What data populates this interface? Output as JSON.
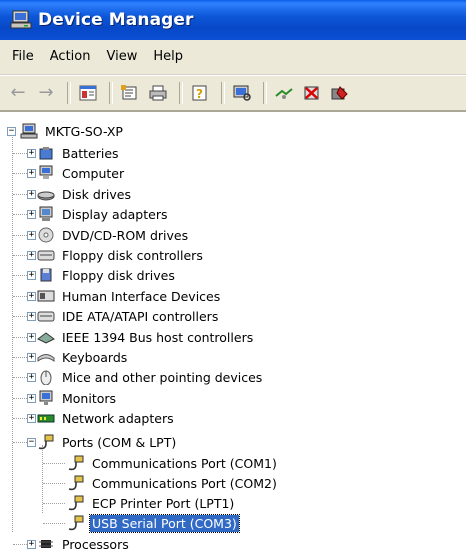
{
  "window": {
    "title": "Device Manager"
  },
  "menu": [
    "File",
    "Action",
    "View",
    "Help"
  ],
  "toolbar_icons": [
    "back-icon",
    "forward-icon",
    "console-tree-icon",
    "properties-icon",
    "print-icon",
    "help-icon",
    "scan-hardware-icon",
    "update-driver-icon",
    "uninstall-icon",
    "disable-icon"
  ],
  "tree": {
    "root": "MKTG-SO-XP",
    "categories": [
      "Batteries",
      "Computer",
      "Disk drives",
      "Display adapters",
      "DVD/CD-ROM drives",
      "Floppy disk controllers",
      "Floppy disk drives",
      "Human Interface Devices",
      "IDE ATA/ATAPI controllers",
      "IEEE 1394 Bus host controllers",
      "Keyboards",
      "Mice and other pointing devices",
      "Monitors",
      "Network adapters"
    ],
    "ports": {
      "label": "Ports (COM & LPT)",
      "children": [
        "Communications Port (COM1)",
        "Communications Port (COM2)",
        "ECP Printer Port (LPT1)",
        "USB Serial Port (COM3)"
      ],
      "selected": "USB Serial Port (COM3)"
    },
    "after": [
      "Processors"
    ]
  }
}
